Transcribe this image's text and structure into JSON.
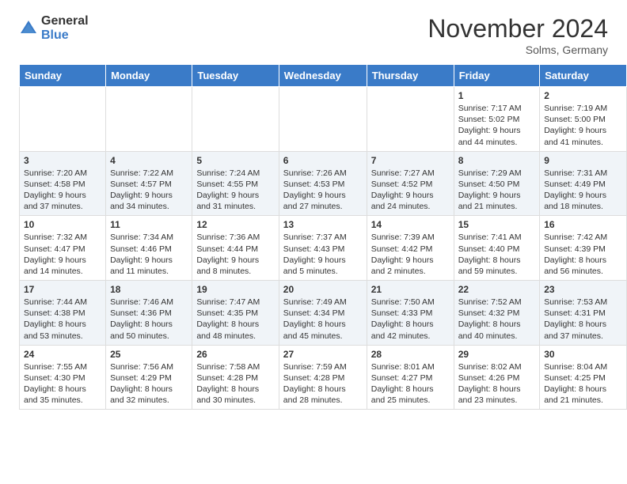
{
  "logo": {
    "general": "General",
    "blue": "Blue"
  },
  "header": {
    "month": "November 2024",
    "location": "Solms, Germany"
  },
  "weekdays": [
    "Sunday",
    "Monday",
    "Tuesday",
    "Wednesday",
    "Thursday",
    "Friday",
    "Saturday"
  ],
  "weeks": [
    [
      {
        "day": "",
        "info": ""
      },
      {
        "day": "",
        "info": ""
      },
      {
        "day": "",
        "info": ""
      },
      {
        "day": "",
        "info": ""
      },
      {
        "day": "",
        "info": ""
      },
      {
        "day": "1",
        "info": "Sunrise: 7:17 AM\nSunset: 5:02 PM\nDaylight: 9 hours\nand 44 minutes."
      },
      {
        "day": "2",
        "info": "Sunrise: 7:19 AM\nSunset: 5:00 PM\nDaylight: 9 hours\nand 41 minutes."
      }
    ],
    [
      {
        "day": "3",
        "info": "Sunrise: 7:20 AM\nSunset: 4:58 PM\nDaylight: 9 hours\nand 37 minutes."
      },
      {
        "day": "4",
        "info": "Sunrise: 7:22 AM\nSunset: 4:57 PM\nDaylight: 9 hours\nand 34 minutes."
      },
      {
        "day": "5",
        "info": "Sunrise: 7:24 AM\nSunset: 4:55 PM\nDaylight: 9 hours\nand 31 minutes."
      },
      {
        "day": "6",
        "info": "Sunrise: 7:26 AM\nSunset: 4:53 PM\nDaylight: 9 hours\nand 27 minutes."
      },
      {
        "day": "7",
        "info": "Sunrise: 7:27 AM\nSunset: 4:52 PM\nDaylight: 9 hours\nand 24 minutes."
      },
      {
        "day": "8",
        "info": "Sunrise: 7:29 AM\nSunset: 4:50 PM\nDaylight: 9 hours\nand 21 minutes."
      },
      {
        "day": "9",
        "info": "Sunrise: 7:31 AM\nSunset: 4:49 PM\nDaylight: 9 hours\nand 18 minutes."
      }
    ],
    [
      {
        "day": "10",
        "info": "Sunrise: 7:32 AM\nSunset: 4:47 PM\nDaylight: 9 hours\nand 14 minutes."
      },
      {
        "day": "11",
        "info": "Sunrise: 7:34 AM\nSunset: 4:46 PM\nDaylight: 9 hours\nand 11 minutes."
      },
      {
        "day": "12",
        "info": "Sunrise: 7:36 AM\nSunset: 4:44 PM\nDaylight: 9 hours\nand 8 minutes."
      },
      {
        "day": "13",
        "info": "Sunrise: 7:37 AM\nSunset: 4:43 PM\nDaylight: 9 hours\nand 5 minutes."
      },
      {
        "day": "14",
        "info": "Sunrise: 7:39 AM\nSunset: 4:42 PM\nDaylight: 9 hours\nand 2 minutes."
      },
      {
        "day": "15",
        "info": "Sunrise: 7:41 AM\nSunset: 4:40 PM\nDaylight: 8 hours\nand 59 minutes."
      },
      {
        "day": "16",
        "info": "Sunrise: 7:42 AM\nSunset: 4:39 PM\nDaylight: 8 hours\nand 56 minutes."
      }
    ],
    [
      {
        "day": "17",
        "info": "Sunrise: 7:44 AM\nSunset: 4:38 PM\nDaylight: 8 hours\nand 53 minutes."
      },
      {
        "day": "18",
        "info": "Sunrise: 7:46 AM\nSunset: 4:36 PM\nDaylight: 8 hours\nand 50 minutes."
      },
      {
        "day": "19",
        "info": "Sunrise: 7:47 AM\nSunset: 4:35 PM\nDaylight: 8 hours\nand 48 minutes."
      },
      {
        "day": "20",
        "info": "Sunrise: 7:49 AM\nSunset: 4:34 PM\nDaylight: 8 hours\nand 45 minutes."
      },
      {
        "day": "21",
        "info": "Sunrise: 7:50 AM\nSunset: 4:33 PM\nDaylight: 8 hours\nand 42 minutes."
      },
      {
        "day": "22",
        "info": "Sunrise: 7:52 AM\nSunset: 4:32 PM\nDaylight: 8 hours\nand 40 minutes."
      },
      {
        "day": "23",
        "info": "Sunrise: 7:53 AM\nSunset: 4:31 PM\nDaylight: 8 hours\nand 37 minutes."
      }
    ],
    [
      {
        "day": "24",
        "info": "Sunrise: 7:55 AM\nSunset: 4:30 PM\nDaylight: 8 hours\nand 35 minutes."
      },
      {
        "day": "25",
        "info": "Sunrise: 7:56 AM\nSunset: 4:29 PM\nDaylight: 8 hours\nand 32 minutes."
      },
      {
        "day": "26",
        "info": "Sunrise: 7:58 AM\nSunset: 4:28 PM\nDaylight: 8 hours\nand 30 minutes."
      },
      {
        "day": "27",
        "info": "Sunrise: 7:59 AM\nSunset: 4:28 PM\nDaylight: 8 hours\nand 28 minutes."
      },
      {
        "day": "28",
        "info": "Sunrise: 8:01 AM\nSunset: 4:27 PM\nDaylight: 8 hours\nand 25 minutes."
      },
      {
        "day": "29",
        "info": "Sunrise: 8:02 AM\nSunset: 4:26 PM\nDaylight: 8 hours\nand 23 minutes."
      },
      {
        "day": "30",
        "info": "Sunrise: 8:04 AM\nSunset: 4:25 PM\nDaylight: 8 hours\nand 21 minutes."
      }
    ]
  ]
}
